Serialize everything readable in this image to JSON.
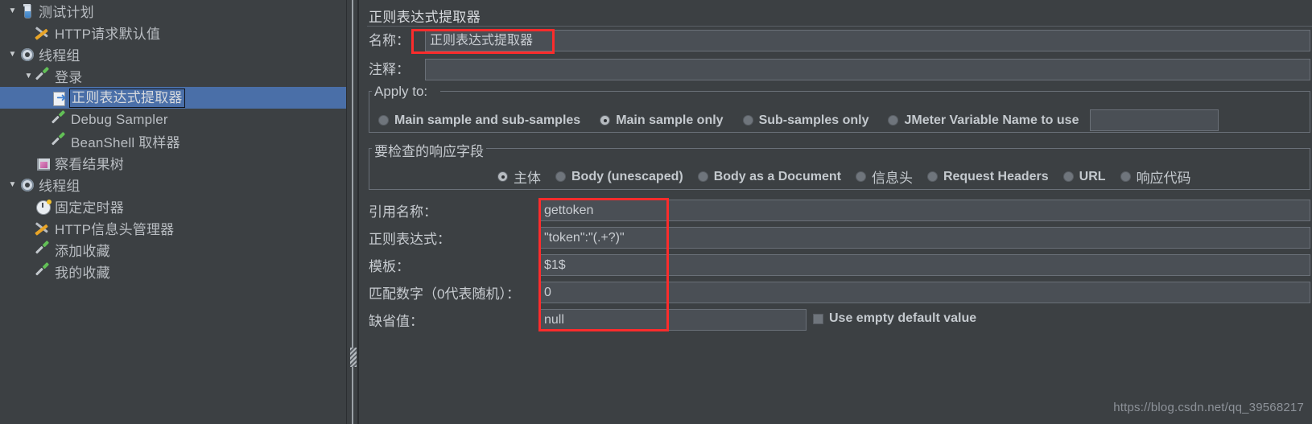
{
  "app": {
    "panel_title": "正则表达式提取器",
    "watermark": "https://blog.csdn.net/qq_39568217",
    "accent_selection": "#4a6fa8",
    "annotation_color": "#fb2c2c",
    "background": "#3c4043"
  },
  "tree": {
    "items": [
      {
        "label": "测试计划",
        "icon": "flask-icon",
        "indent": 0,
        "twisty": "▼",
        "selected": false
      },
      {
        "label": "HTTP请求默认值",
        "icon": "wrench-icon",
        "indent": 1,
        "twisty": "",
        "selected": false
      },
      {
        "label": "线程组",
        "icon": "gear-icon",
        "indent": 0,
        "twisty": "▼",
        "selected": false
      },
      {
        "label": "登录",
        "icon": "pipette-icon",
        "indent": 1,
        "twisty": "▼",
        "selected": false
      },
      {
        "label": "正则表达式提取器",
        "icon": "regex-icon",
        "indent": 2,
        "twisty": "",
        "selected": true
      },
      {
        "label": "Debug Sampler",
        "icon": "pipette-icon",
        "indent": 2,
        "twisty": "",
        "selected": false
      },
      {
        "label": "BeanShell 取样器",
        "icon": "pipette-icon",
        "indent": 2,
        "twisty": "",
        "selected": false
      },
      {
        "label": "察看结果树",
        "icon": "results-tree-icon",
        "indent": 1,
        "twisty": "",
        "selected": false
      },
      {
        "label": "线程组",
        "icon": "gear-icon",
        "indent": 0,
        "twisty": "▼",
        "selected": false
      },
      {
        "label": "固定定时器",
        "icon": "timer-icon",
        "indent": 1,
        "twisty": "",
        "selected": false
      },
      {
        "label": "HTTP信息头管理器",
        "icon": "wrench-icon",
        "indent": 1,
        "twisty": "",
        "selected": false
      },
      {
        "label": "添加收藏",
        "icon": "pipette-icon",
        "indent": 1,
        "twisty": "",
        "selected": false
      },
      {
        "label": "我的收藏",
        "icon": "pipette-icon",
        "indent": 1,
        "twisty": "",
        "selected": false
      }
    ]
  },
  "form": {
    "name_label": "名称：",
    "name_value": "正则表达式提取器",
    "comment_label": "注释：",
    "comment_value": ""
  },
  "apply_to": {
    "title": "Apply to:",
    "options": [
      {
        "label": "Main sample and sub-samples",
        "selected": false
      },
      {
        "label": "Main sample only",
        "selected": true
      },
      {
        "label": "Sub-samples only",
        "selected": false
      },
      {
        "label": "JMeter Variable Name to use",
        "selected": false
      }
    ],
    "variable_value": ""
  },
  "response_field": {
    "title": "要检查的响应字段",
    "options": [
      {
        "label": "主体",
        "selected": true,
        "cjk": true
      },
      {
        "label": "Body (unescaped)",
        "selected": false,
        "cjk": false
      },
      {
        "label": "Body as a Document",
        "selected": false,
        "cjk": false
      },
      {
        "label": "信息头",
        "selected": false,
        "cjk": true
      },
      {
        "label": "Request Headers",
        "selected": false,
        "cjk": false
      },
      {
        "label": "URL",
        "selected": false,
        "cjk": false
      },
      {
        "label": "响应代码",
        "selected": false,
        "cjk": true
      }
    ]
  },
  "extractor": {
    "rows": [
      {
        "label": "引用名称：",
        "value": "gettoken"
      },
      {
        "label": "正则表达式：",
        "value": "\"token\":\"(.+?)\""
      },
      {
        "label": "模板：",
        "value": "$1$"
      },
      {
        "label": "匹配数字（0代表随机）：",
        "value": "0"
      },
      {
        "label": "缺省值：",
        "value": "null"
      }
    ],
    "use_empty_default_label": "Use empty default value",
    "use_empty_default_checked": false
  }
}
